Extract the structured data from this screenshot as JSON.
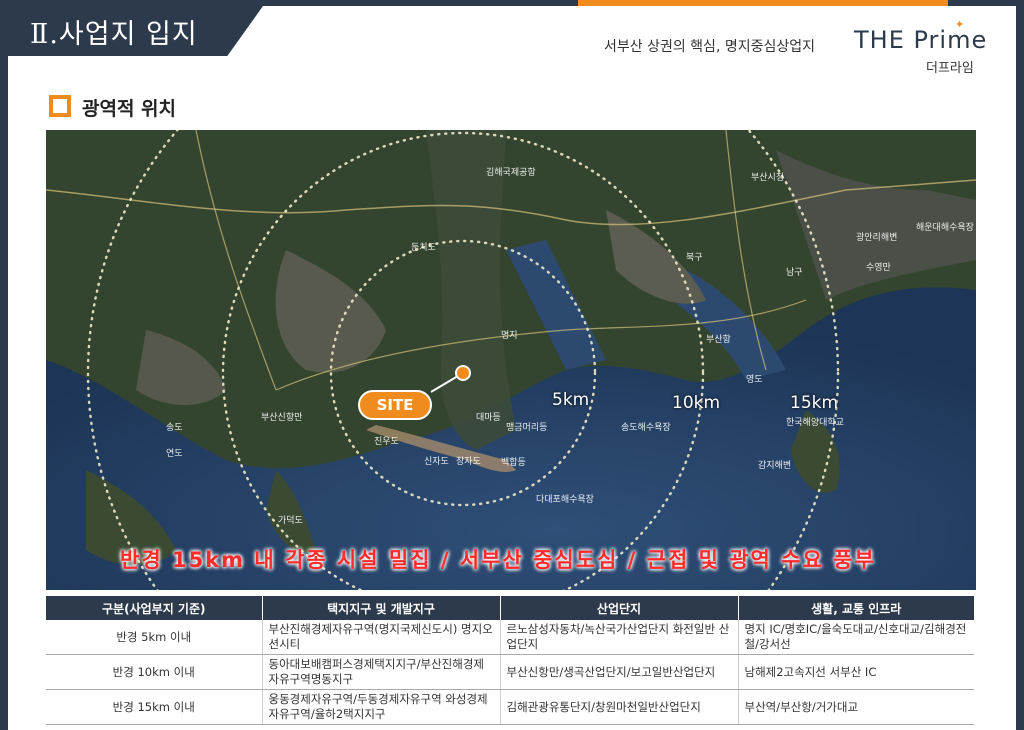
{
  "header": {
    "section_title": "Ⅱ.사업지 입지",
    "tagline": "서부산 상권의 핵심, 명지중심상업지",
    "brand_en": "THE Prime",
    "brand_ko": "더프라임"
  },
  "sub_heading": "광역적 위치",
  "map": {
    "site_label": "SITE",
    "rings": [
      "5km",
      "10km",
      "15km"
    ],
    "banner": "반경 15km 내 각종 시설 밀집 / 서부산 중심도심 / 근접 및 광역 수요 풍부",
    "place_labels": [
      "부산시청",
      "김해국제공항",
      "둔치도",
      "명지",
      "진우도",
      "신자도",
      "장자도",
      "대마등",
      "맹금머리등",
      "백합등",
      "다대포해수욕장",
      "송도해수욕장",
      "부산항",
      "해운대해수욕장",
      "광안리해변",
      "감지해변",
      "한국해양대학교",
      "가덕도",
      "송도",
      "연도",
      "부산신항만",
      "영도",
      "북구",
      "남구",
      "수영만"
    ]
  },
  "table": {
    "headers": [
      "구분(사업부지 기준)",
      "택지지구 및 개발지구",
      "산업단지",
      "생활, 교통 인프라"
    ],
    "rows": [
      {
        "label": "반경 5km 이내",
        "development": "부산진해경제자유구역(명지국제신도시) 명지오션시티",
        "industrial": "르노삼성자동차/녹산국가산업단지 화전일반 산업단지",
        "infra": "명지 IC/명호IC/을숙도대교/신호대교/김해경전철/강서선"
      },
      {
        "label": "반경 10km 이내",
        "development": "동아대보배캠퍼스경제택지지구/부산진해경제자유구역명동지구",
        "industrial": "부산신항만/생곡산업단지/보고일반산업단지",
        "infra": "남해제2고속지선 서부산 IC"
      },
      {
        "label": "반경 15km 이내",
        "development": "웅동경제자유구역/두동경제자유구역 와성경제자유구역/율하2택지지구",
        "industrial": "김해관광유통단지/창원마천일반산업단지",
        "infra": "부산역/부산항/거가대교"
      }
    ]
  }
}
